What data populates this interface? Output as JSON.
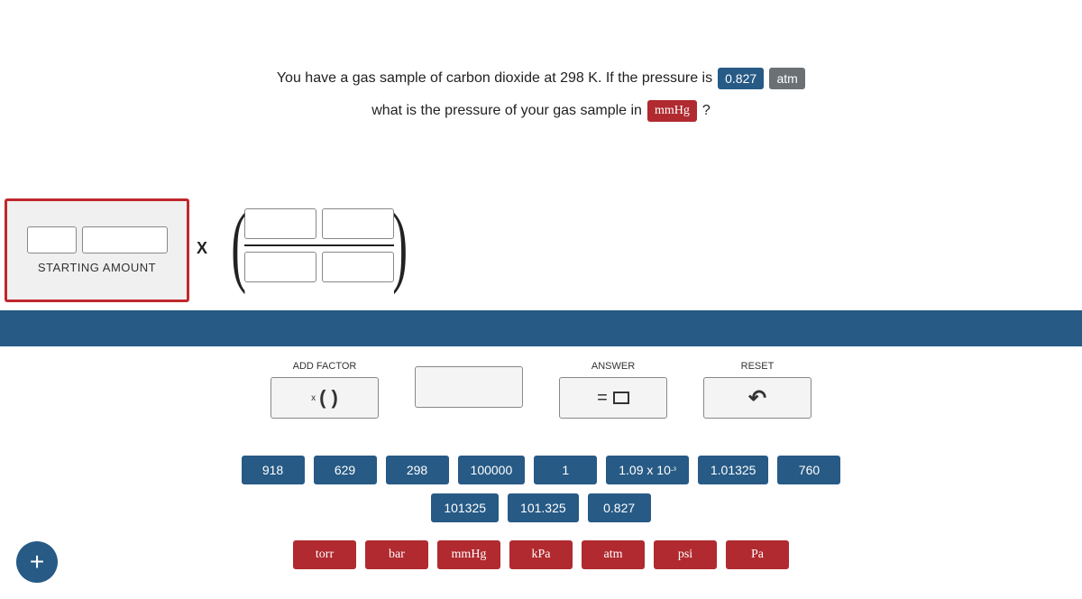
{
  "question": {
    "line1_prefix": "You have a gas sample of carbon dioxide at 298 K. If the pressure is",
    "pressure_value": "0.827",
    "pressure_unit": "atm",
    "line2_prefix": "what is the pressure of your gas sample in",
    "target_unit": "mmHg",
    "line2_suffix": "?"
  },
  "starting_amount_label": "STARTING AMOUNT",
  "multiply_symbol": "X",
  "tools": {
    "add_factor": {
      "label": "ADD FACTOR",
      "symbol_prefix": "x",
      "symbol": "(   )"
    },
    "blank": {
      "label": ""
    },
    "answer": {
      "label": "ANSWER",
      "eq": "="
    },
    "reset": {
      "label": "RESET",
      "icon": "↶"
    }
  },
  "number_tiles_row1": [
    "918",
    "629",
    "298",
    "100000",
    "1",
    "1.09 x 10⁻³",
    "1.01325",
    "760"
  ],
  "number_tiles_row2": [
    "101325",
    "101.325",
    "0.827"
  ],
  "unit_tiles": [
    "torr",
    "bar",
    "mmHg",
    "kPa",
    "atm",
    "psi",
    "Pa"
  ],
  "plus": "+"
}
